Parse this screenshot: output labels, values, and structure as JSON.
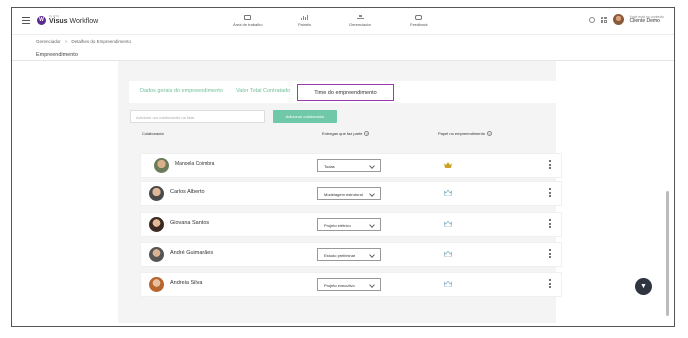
{
  "header": {
    "logo_small": "by HYS",
    "logo_brand": "Visus",
    "logo_product": "Workflow",
    "nav": [
      {
        "label": "Área de trabalho",
        "icon": "monitor-icon"
      },
      {
        "label": "Painéis",
        "icon": "bar-chart-icon"
      },
      {
        "label": "Gerenciador",
        "icon": "hierarchy-icon"
      },
      {
        "label": "Feedback",
        "icon": "chat-icon"
      }
    ],
    "user_label": "Você está no contexto",
    "user_name": "Cliente Demo"
  },
  "breadcrumb": {
    "items": [
      "Gerenciador",
      "Detalhes do Empreendimento"
    ],
    "separator": ">"
  },
  "section_title": "Empreendimento",
  "tabs": [
    {
      "label": "Dados gerais do empreendimento"
    },
    {
      "label": "Valor Total Contratado"
    },
    {
      "label": "Time do empreendimento"
    }
  ],
  "search": {
    "placeholder": "Adicione um colaborador na lista"
  },
  "add_button": "Adicionar colaborador",
  "columns": {
    "collaborator": "Colaborador",
    "deliverables": "Entregas que faz parte",
    "role": "Papel no empreendimento"
  },
  "rows": [
    {
      "name": "Manoela Coimbra",
      "deliverable": "Todas"
    },
    {
      "name": "Carlos Alberto",
      "deliverable": "Modelagem estrutural"
    },
    {
      "name": "Giovana Santos",
      "deliverable": "Projeto elétrico"
    },
    {
      "name": "André Guimarães",
      "deliverable": "Estudo preliminar"
    },
    {
      "name": "Andreia Silva",
      "deliverable": "Projeto executivo"
    }
  ],
  "colors": {
    "accent_green": "#6fc8a8",
    "active_tab_border": "#9c3bb0",
    "crown": "#8fb8c9",
    "crown_gold": "#c9a227"
  }
}
